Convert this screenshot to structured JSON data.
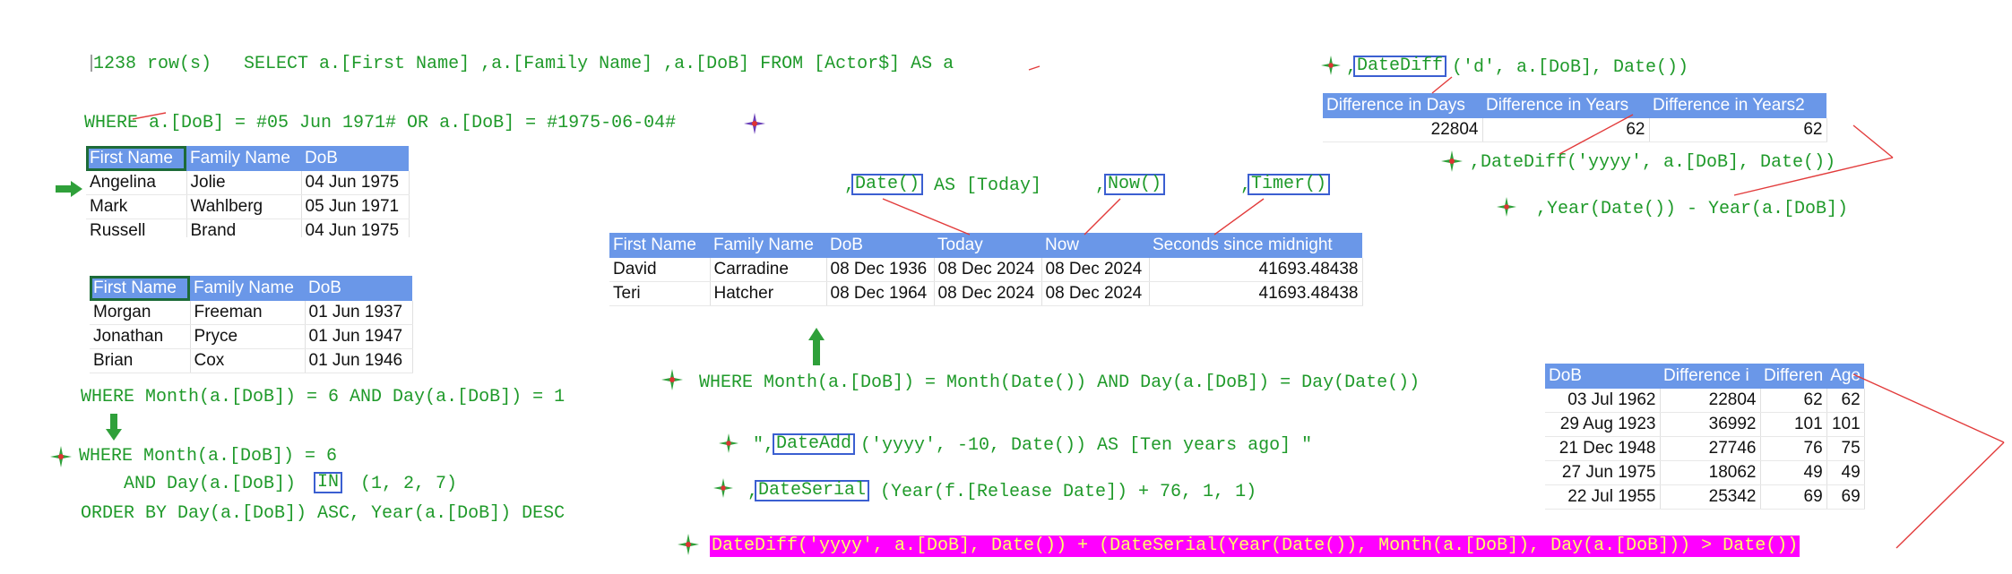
{
  "queries": {
    "q_main": "1238 row(s)   SELECT a.[First Name] ,a.[Family Name] ,a.[DoB] FROM [Actor$] AS a",
    "q_where_dob": "WHERE a.[DoB] = #05 Jun 1971# OR a.[DoB] = #1975-06-04#",
    "q_where_month_day": "WHERE Month(a.[DoB]) = 6 AND Day(a.[DoB]) = 1",
    "q_where_month_only": "WHERE Month(a.[DoB]) = 6",
    "q_and_day_prefix": "AND Day(a.[DoB])",
    "q_in_keyword": "IN",
    "q_in_list": "(1, 2, 7)",
    "q_order_by": "ORDER BY Day(a.[DoB]) ASC, Year(a.[DoB]) DESC",
    "q_date_fn": "Date()",
    "q_date_alias": "AS [Today]",
    "q_now_fn": "Now()",
    "q_timer_fn": "Timer()",
    "q_where_today": "WHERE Month(a.[DoB]) = Month(Date()) AND Day(a.[DoB]) = Day(Date())",
    "q_dateadd_fn": "DateAdd",
    "q_dateadd_rest": "('yyyy', -10, Date()) AS [Ten years ago] \"",
    "q_dateserial_fn": "DateSerial",
    "q_dateserial_rest": "(Year(f.[Release Date]) + 76, 1, 1)",
    "q_age_expr": "DateDiff('yyyy', a.[DoB], Date()) + (DateSerial(Year(Date()), Month(a.[DoB]), Day(a.[DoB])) > Date())",
    "q_datediff_fn": "DateDiff",
    "q_datediff_d_rest": "('d', a.[DoB], Date())",
    "q_datediff_yyyy": ",DateDiff('yyyy', a.[DoB], Date())",
    "q_year_diff": ",Year(Date()) - Year(a.[DoB])"
  },
  "table_dob_match": {
    "headers": [
      "First Name",
      "Family Name",
      "DoB"
    ],
    "rows": [
      [
        "Angelina",
        "Jolie",
        "04 Jun 1975"
      ],
      [
        "Mark",
        "Wahlberg",
        "05 Jun 1971"
      ],
      [
        "Russell",
        "Brand",
        "04 Jun 1975"
      ]
    ]
  },
  "table_june_first": {
    "headers": [
      "First Name",
      "Family Name",
      "DoB"
    ],
    "rows": [
      [
        "Morgan",
        "Freeman",
        "01 Jun 1937"
      ],
      [
        "Jonathan",
        "Pryce",
        "01 Jun 1947"
      ],
      [
        "Brian",
        "Cox",
        "01 Jun 1946"
      ]
    ]
  },
  "table_today": {
    "headers": [
      "First Name",
      "Family Name",
      "DoB",
      "Today",
      "Now",
      "Seconds since midnight"
    ],
    "rows": [
      [
        "David",
        "Carradine",
        "08 Dec 1936",
        "08 Dec 2024",
        "08 Dec 2024",
        "41693.48438"
      ],
      [
        "Teri",
        "Hatcher",
        "08 Dec 1964",
        "08 Dec 2024",
        "08 Dec 2024",
        "41693.48438"
      ]
    ]
  },
  "table_diff": {
    "headers": [
      "Difference in Days",
      "Difference in Years",
      "Difference in Years2"
    ],
    "rows": [
      [
        "22804",
        "62",
        "62"
      ]
    ]
  },
  "table_age": {
    "headers": [
      "DoB",
      "Difference i",
      "Differen",
      "Age"
    ],
    "rows": [
      [
        "03 Jul 1962",
        "22804",
        "62",
        "62"
      ],
      [
        "29 Aug 1923",
        "36992",
        "101",
        "101"
      ],
      [
        "21 Dec 1948",
        "27746",
        "76",
        "75"
      ],
      [
        "27 Jun 1975",
        "18062",
        "49",
        "49"
      ],
      [
        "22 Jul 1955",
        "25342",
        "69",
        "69"
      ]
    ]
  },
  "colors": {
    "code_green": "#1f9a2a",
    "header_blue": "#6a97e8",
    "box_blue": "#3b5fd1",
    "highlight_magenta": "#ff00ff",
    "annotation_red": "#e23b3b"
  }
}
